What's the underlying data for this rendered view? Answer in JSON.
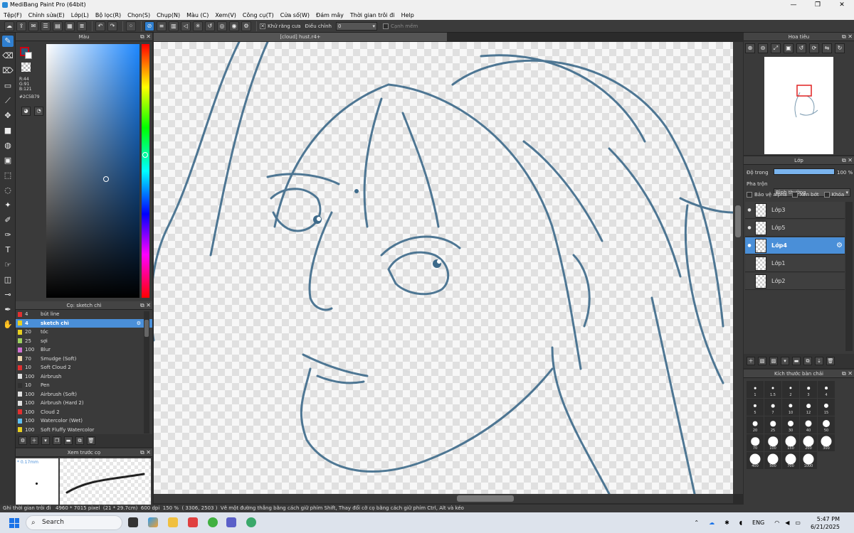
{
  "window": {
    "title": "MediBang Paint Pro (64bit)"
  },
  "menubar": [
    "Tệp(F)",
    "Chỉnh sửa(E)",
    "Lớp(L)",
    "Bộ lọc(R)",
    "Chọn(S)",
    "Chụp(N)",
    "Màu (C)",
    "Xem(V)",
    "Công cụ(T)",
    "Cửa số(W)",
    "Đám mây",
    "Thời gian trôi đi",
    "Help"
  ],
  "toolbar": {
    "antialias_label": "Khử răng cưa",
    "adjust_label": "Điều chỉnh",
    "adjust_value": "0",
    "edge_label": "Cạnh mềm"
  },
  "color_panel": {
    "title": "Màu",
    "r": "R:44",
    "g": "G:91",
    "b": "B:121",
    "hex": "#2C5B79",
    "current_color": "#2c5b79"
  },
  "brush_panel": {
    "title": "Cọ: sketch chì",
    "brushes": [
      {
        "size": "4",
        "name": "bút line",
        "color": "#e03030"
      },
      {
        "size": "4",
        "name": "sketch chì",
        "color": "#e8d020"
      },
      {
        "size": "20",
        "name": "tóc",
        "color": "#e8d020"
      },
      {
        "size": "25",
        "name": "sợi",
        "color": "#9fd060"
      },
      {
        "size": "100",
        "name": "Blur",
        "color": "#d070d0"
      },
      {
        "size": "70",
        "name": "Smudge (Soft)",
        "color": "#f0d8b0"
      },
      {
        "size": "10",
        "name": "Soft Cloud 2",
        "color": "#e03030"
      },
      {
        "size": "100",
        "name": "Airbrush",
        "color": "#e0e0e0"
      },
      {
        "size": "10",
        "name": "Pen",
        "color": "#303030"
      },
      {
        "size": "100",
        "name": "Airbrush (Soft)",
        "color": "#e0e0e0"
      },
      {
        "size": "100",
        "name": "Airbrush (Hard 2)",
        "color": "#e0e0e0"
      },
      {
        "size": "100",
        "name": "Cloud 2",
        "color": "#e03030"
      },
      {
        "size": "100",
        "name": "Watercolor (Wet)",
        "color": "#60c0f0"
      },
      {
        "size": "100",
        "name": "Soft Fluffy Watercolor",
        "color": "#e8d020"
      }
    ]
  },
  "preview_panel": {
    "title": "Xem trước cọ",
    "size_label": "* 0.17mm"
  },
  "document": {
    "tab": "[cloud] hust.r4+"
  },
  "navigator": {
    "title": "Hoa tiêu"
  },
  "layer_panel": {
    "title": "Lớp",
    "opacity_label": "Độ trong",
    "opacity_value": "100 %",
    "blend_label": "Pha trộn",
    "blend_value": "Bình thường",
    "protect_alpha": "Bảo vệ alpha",
    "clipping": "Xén bớt",
    "lock": "Khóa",
    "layers": [
      {
        "name": "Lớp3",
        "visible": true
      },
      {
        "name": "Lớp5",
        "visible": true
      },
      {
        "name": "Lớp4",
        "visible": true
      },
      {
        "name": "Lớp1",
        "visible": false
      },
      {
        "name": "Lớp2",
        "visible": false
      }
    ]
  },
  "brush_size_panel": {
    "title": "Kích thước bàn chải",
    "sizes": [
      "1",
      "1.5",
      "2",
      "3",
      "4",
      "5",
      "7",
      "10",
      "12",
      "15",
      "20",
      "25",
      "30",
      "40",
      "50",
      "70",
      "100",
      "150",
      "200",
      "300",
      "400",
      "500",
      "700",
      "1000"
    ]
  },
  "statusbar": {
    "time_lapse": "Ghi thời gian trôi đi",
    "dimensions": "4960 * 7015 pixel",
    "physical": "(21 * 29.7cm)",
    "dpi": "600 dpi",
    "zoom": "150 %",
    "coords": "( 3306, 2503 )",
    "hint": "Vẽ một đường thẳng bằng cách giữ phím Shift, Thay đổi cỡ cọ bằng cách giữ phím Ctrl, Alt và kéo"
  },
  "taskbar": {
    "search_placeholder": "Search",
    "lang": "ENG",
    "time": "5:47 PM",
    "date": "6/21/2025"
  }
}
